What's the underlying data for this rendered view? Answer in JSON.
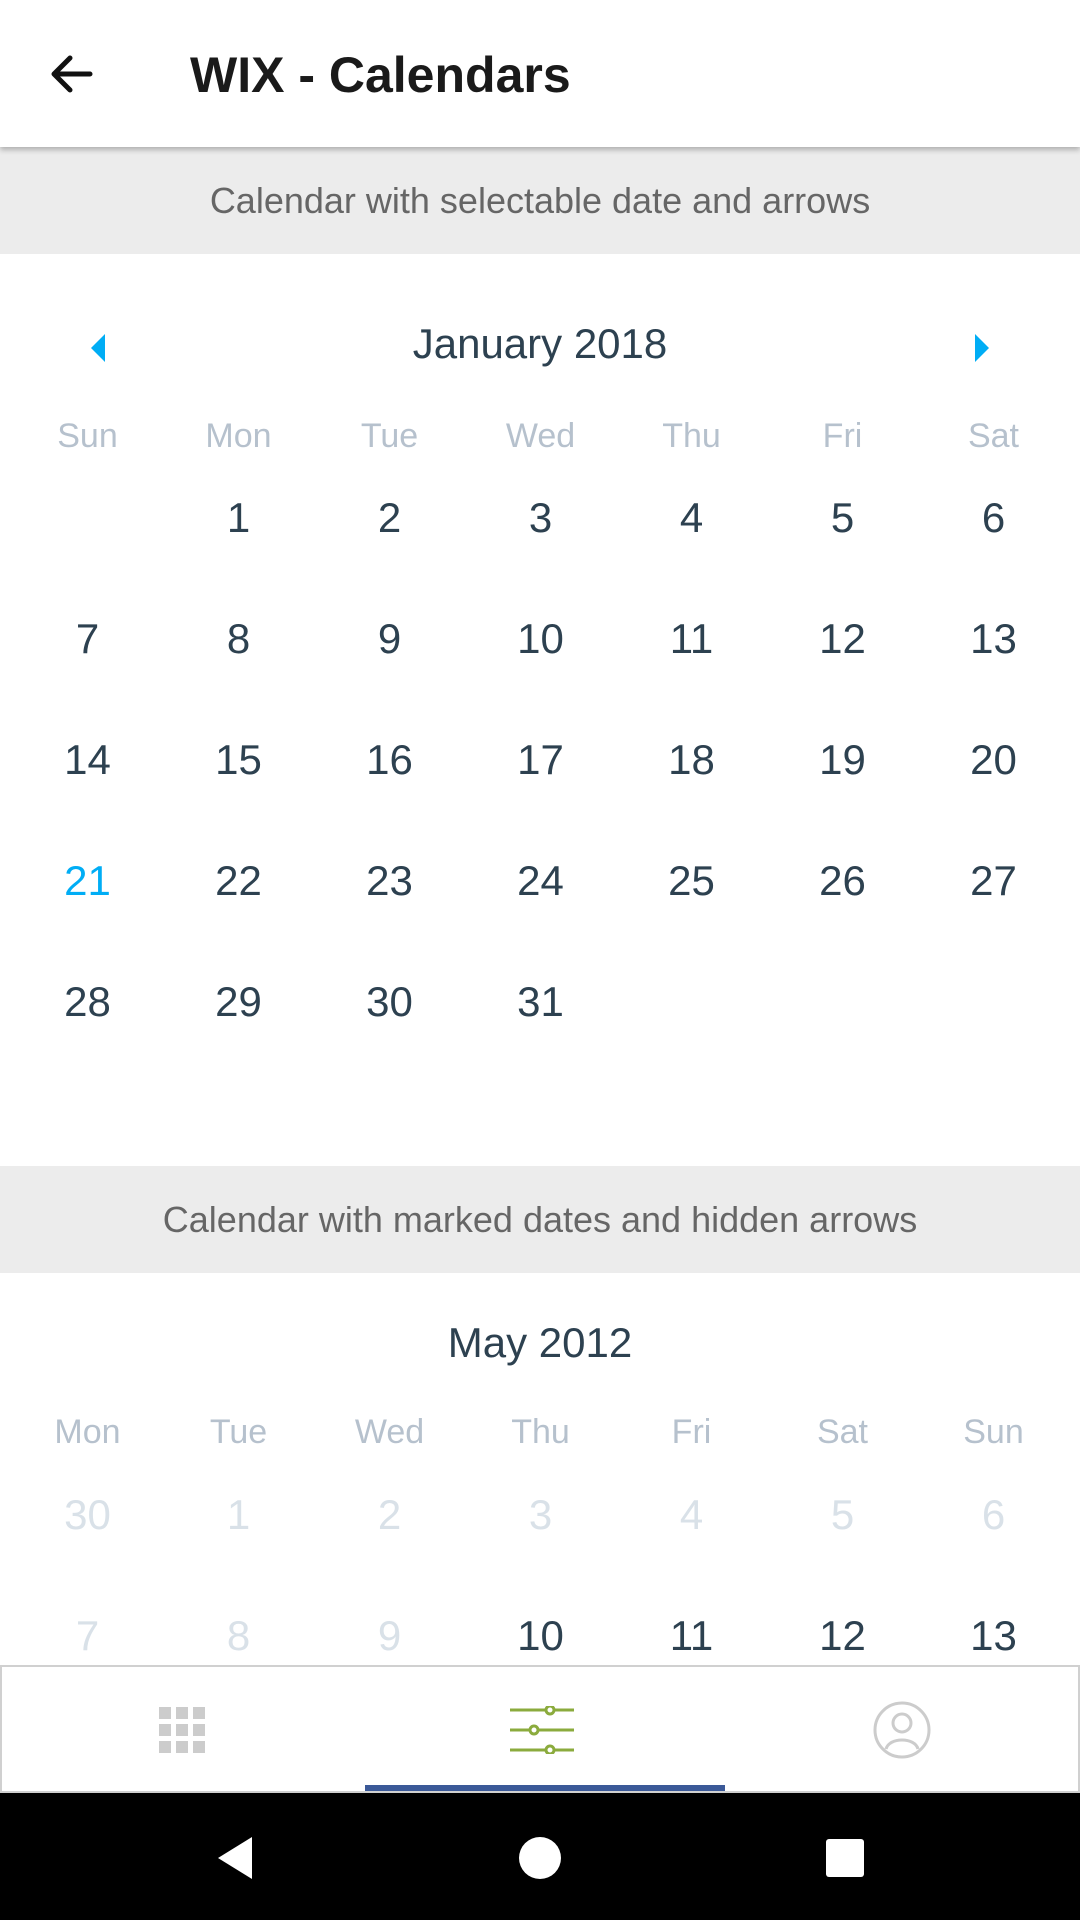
{
  "app_bar": {
    "title": "WIX - Calendars",
    "back_icon": "arrow-left-icon"
  },
  "calendar1": {
    "header": "Calendar with selectable date and arrows",
    "month": "January 2018",
    "left_arrow_icon": "caret-left-icon",
    "right_arrow_icon": "caret-right-icon",
    "accent_color": "#00adf5",
    "weekdays": [
      "Sun",
      "Mon",
      "Tue",
      "Wed",
      "Thu",
      "Fri",
      "Sat"
    ],
    "days": [
      "",
      "1",
      "2",
      "3",
      "4",
      "5",
      "6",
      "7",
      "8",
      "9",
      "10",
      "11",
      "12",
      "13",
      "14",
      "15",
      "16",
      "17",
      "18",
      "19",
      "20",
      "21",
      "22",
      "23",
      "24",
      "25",
      "26",
      "27",
      "28",
      "29",
      "30",
      "31",
      "",
      "",
      ""
    ],
    "selected_day": "21"
  },
  "calendar2": {
    "header": "Calendar with marked dates and hidden arrows",
    "month": "May 2012",
    "weekdays": [
      "Mon",
      "Tue",
      "Wed",
      "Thu",
      "Fri",
      "Sat",
      "Sun"
    ],
    "days": [
      "30",
      "1",
      "2",
      "3",
      "4",
      "5",
      "6",
      "7",
      "8",
      "9",
      "10",
      "11",
      "12",
      "13"
    ],
    "disabled_days": [
      "30",
      "1",
      "2",
      "3",
      "4",
      "5",
      "6",
      "7",
      "8",
      "9"
    ]
  },
  "bottom_nav": {
    "items": [
      {
        "icon": "grid-icon",
        "active": false,
        "color": "#cccccc"
      },
      {
        "icon": "sliders-icon",
        "active": true,
        "color": "#8bab3d"
      },
      {
        "icon": "user-icon",
        "active": false,
        "color": "#cccccc"
      }
    ],
    "indicator_color": "#3b5998"
  },
  "system_nav": {
    "back_icon": "system-back-icon",
    "home_icon": "system-home-icon",
    "recents_icon": "system-recents-icon"
  }
}
